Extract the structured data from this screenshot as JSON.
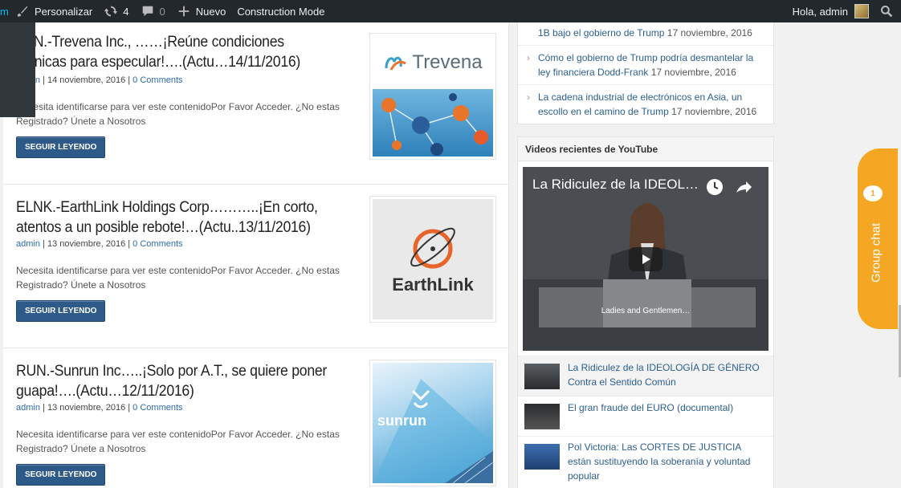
{
  "adminbar": {
    "site_stub": "m",
    "customize": "Personalizar",
    "updates_count": "4",
    "comments_count": "0",
    "new": "Nuevo",
    "construction": "Construction Mode",
    "greeting": "Hola, admin"
  },
  "posts": [
    {
      "title": "AVN.-Trevena Inc., ……¡Reúne condiciones técnicas para especular!….(Actu…14/11/2016)",
      "author": "admin",
      "date": "14 noviembre, 2016",
      "comments": "0 Comments",
      "excerpt": "Necesita identificarse para ver este contenidoPor Favor Acceder. ¿No estas Registrado? Únete a Nosotros",
      "button": "SEGUIR LEYENDO",
      "thumb_label": "Trevena"
    },
    {
      "title": "ELNK.-EarthLink Holdings Corp………..¡En corto, atentos a un posible rebote!…(Actu..13/11/2016)",
      "author": "admin",
      "date": "13 noviembre, 2016",
      "comments": "0 Comments",
      "excerpt": "Necesita identificarse para ver este contenidoPor Favor Acceder. ¿No estas Registrado? Únete a Nosotros",
      "button": "SEGUIR LEYENDO",
      "thumb_label": "EarthLink"
    },
    {
      "title": "RUN.-Sunrun Inc…..¡Solo por A.T., se quiere poner guapa!….(Actu…12/11/2016)",
      "author": "admin",
      "date": "13 noviembre, 2016",
      "comments": "0 Comments",
      "excerpt": "Necesita identificarse para ver este contenidoPor Favor Acceder. ¿No estas Registrado? Únete a Nosotros",
      "button": "SEGUIR LEYENDO",
      "thumb_label": "sunrun"
    }
  ],
  "sidebar": {
    "news": [
      {
        "title": "1B bajo el gobierno de Trump",
        "date": "17 noviembre, 2016"
      },
      {
        "title": "Cómo el gobierno de Trump podría desmantelar la ley financiera Dodd-Frank",
        "date": "17 noviembre, 2016"
      },
      {
        "title": "La cadena industrial de electrónicos en Asia, un escollo en el camino de Trump",
        "date": "17 noviembre, 2016"
      }
    ],
    "youtube": {
      "title": "Videos recientes de YouTube",
      "player_title": "La Ridiculez de la IDEOL…",
      "player_caption": "Ladies and Gentlemen…",
      "videos": [
        "La Ridiculez de la IDEOLOGÍA DE GÉNERO Contra el Sentido Común",
        "El gran fraude del EURO (documental)",
        "Pol Victoria: Las CORTES DE JUSTICIA están sustituyendo la soberanía y voluntad popular"
      ]
    }
  },
  "group_chat": {
    "label": "Group chat",
    "badge": "1"
  },
  "colors": {
    "adminbar": "#23282d",
    "button": "#2e5a8a",
    "link": "#2b5f8e",
    "chat": "#f5a623"
  }
}
